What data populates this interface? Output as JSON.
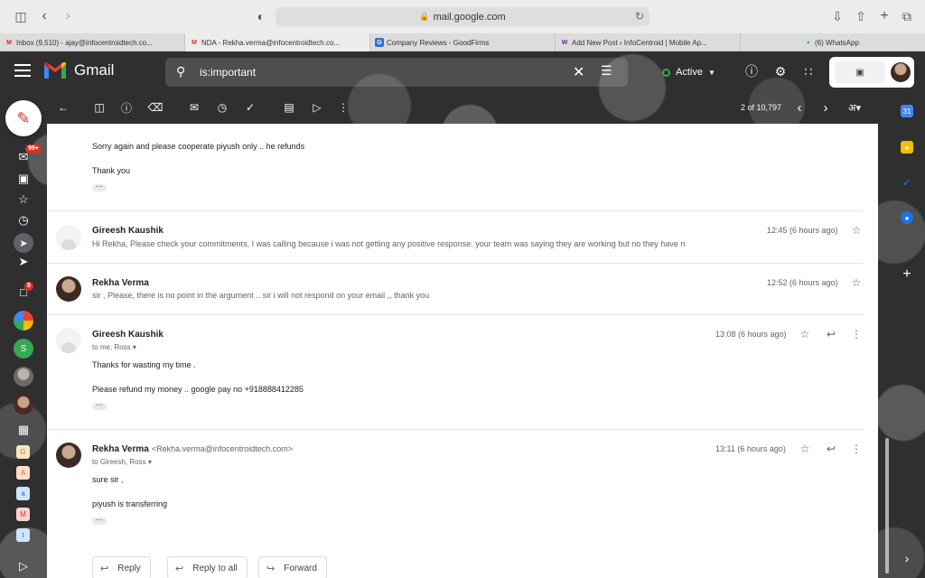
{
  "browser": {
    "url": "mail.google.com",
    "tabs": [
      {
        "label": "Inbox (9,510) - ajay@infocentroidtech.co...",
        "favicon": "M",
        "favicon_color": "#d93025"
      },
      {
        "label": "NDA - Rekha.verma@infocentroidtech.co...",
        "favicon": "M",
        "favicon_color": "#d93025"
      },
      {
        "label": "Company Reviews - GoodFirms",
        "favicon": "G",
        "favicon_color": "#2f6fd8"
      },
      {
        "label": "Add New Post ‹ InfoCentroid | Mobile Ap...",
        "favicon": "W",
        "favicon_color": "#5c2d91"
      },
      {
        "label": "(6) WhatsApp",
        "favicon": "●",
        "favicon_color": "#25d366"
      }
    ]
  },
  "header": {
    "app_name": "Gmail",
    "search_value": "is:important",
    "status": "Active"
  },
  "rail": {
    "mail_badge": "99+",
    "chat_badge": "5",
    "avatar_s": "S",
    "apps": [
      "G",
      "A",
      "a",
      "M",
      "t"
    ]
  },
  "toolbar": {
    "pager": "2 of 10,797",
    "lang": "अ"
  },
  "thread": {
    "top_lines": [
      "Sorry again and please cooperate piyush only .. he refunds",
      "Thank you"
    ],
    "messages": [
      {
        "sender": "Gireesh Kaushik",
        "snippet": "Hi Rekha, Please check your commitments, I was calling because i was not getting any positive response. your team was saying they are working but no they have n",
        "time": "12:45 (6 hours ago)"
      },
      {
        "sender": "Rekha Verma",
        "snippet": "sir , Please, there is no point in the argument .. sir i will not respond on your email ,, thank you",
        "time": "12:52 (6 hours ago)"
      },
      {
        "sender": "Gireesh Kaushik",
        "recipients": "to me, Ross",
        "time": "13:08 (6 hours ago)",
        "body": [
          "Thanks for wasting my time .",
          "Please refund my money .. google pay no +918888412285"
        ]
      },
      {
        "sender": "Rekha Verma",
        "address": "<Rekha.verma@infocentroidtech.com>",
        "recipients": "to Gireesh, Ross",
        "time": "13:11 (6 hours ago)",
        "body": [
          "sure sir ,",
          "piyush is transferring"
        ]
      }
    ]
  },
  "actions": {
    "reply": "Reply",
    "reply_all": "Reply to all",
    "forward": "Forward"
  },
  "colors": {
    "gmail_red": "#d93025",
    "active_green": "#34a853"
  }
}
